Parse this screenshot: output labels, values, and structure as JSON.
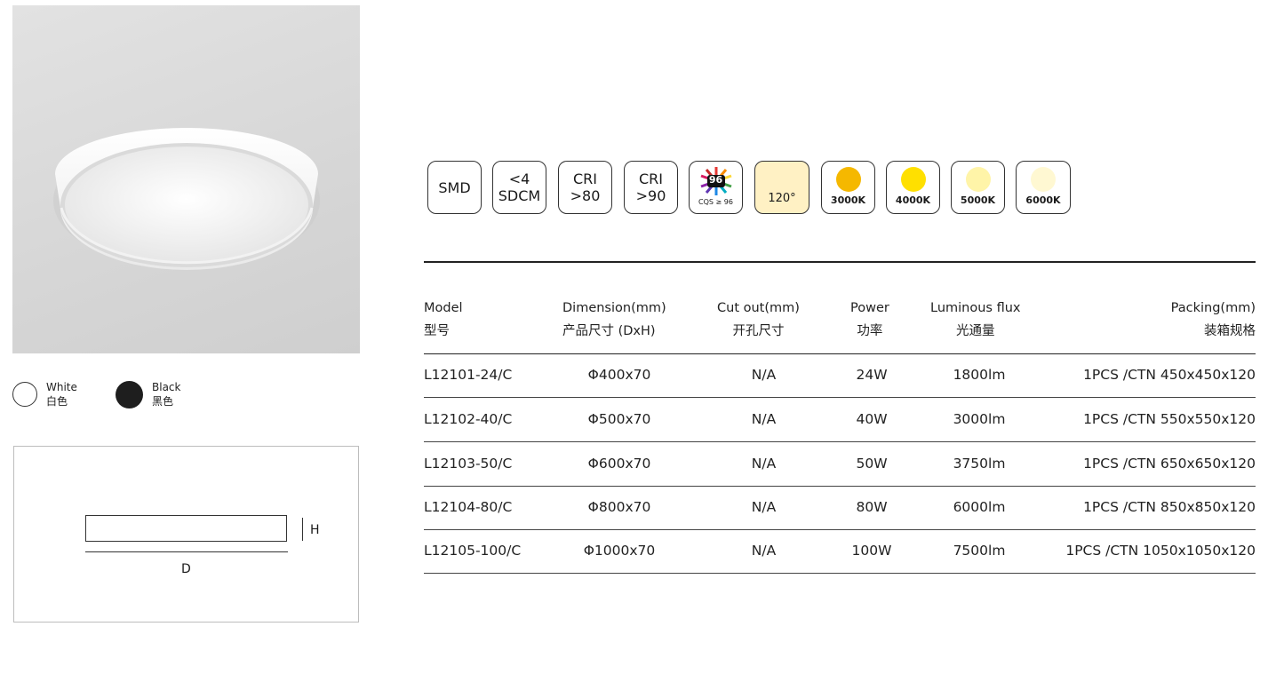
{
  "colors": {
    "white": "#ffffff",
    "black": "#1e1e1e",
    "k3000": "#f5b800",
    "k4000": "#ffe000",
    "k5000": "#fff4a8",
    "k6000": "#fff8d2",
    "beam": "#fff1c4"
  },
  "finishes": [
    {
      "en": "White",
      "zh": "白色"
    },
    {
      "en": "Black",
      "zh": "黑色"
    }
  ],
  "diagram": {
    "h_label": "H",
    "d_label": "D"
  },
  "features": {
    "smd": "SMD",
    "sdcm_line1": "<4",
    "sdcm_line2": "SDCM",
    "cri80_line1": "CRI",
    "cri80_line2": ">80",
    "cri90_line1": "CRI",
    "cri90_line2": ">90",
    "cqs_value": "96",
    "cqs_label": "CQS ≥ 96",
    "beam": "120°",
    "cct": [
      "3000K",
      "4000K",
      "5000K",
      "6000K"
    ]
  },
  "table": {
    "headers": [
      {
        "en": "Model",
        "zh": "型号"
      },
      {
        "en": "Dimension(mm)",
        "zh": "产品尺寸 (DxH)"
      },
      {
        "en": "Cut out(mm)",
        "zh": "开孔尺寸"
      },
      {
        "en": "Power",
        "zh": "功率"
      },
      {
        "en": "Luminous flux",
        "zh": "光通量"
      },
      {
        "en": "Packing(mm)",
        "zh": "装箱规格"
      }
    ],
    "rows": [
      {
        "model": "L12101-24/C",
        "dimension": "Φ400x70",
        "cutout": "N/A",
        "power": "24W",
        "flux": "1800lm",
        "packing": "1PCS /CTN 450x450x120"
      },
      {
        "model": "L12102-40/C",
        "dimension": "Φ500x70",
        "cutout": "N/A",
        "power": "40W",
        "flux": "3000lm",
        "packing": "1PCS /CTN 550x550x120"
      },
      {
        "model": "L12103-50/C",
        "dimension": "Φ600x70",
        "cutout": "N/A",
        "power": "50W",
        "flux": "3750lm",
        "packing": "1PCS /CTN 650x650x120"
      },
      {
        "model": "L12104-80/C",
        "dimension": "Φ800x70",
        "cutout": "N/A",
        "power": "80W",
        "flux": "6000lm",
        "packing": "1PCS /CTN 850x850x120"
      },
      {
        "model": "L12105-100/C",
        "dimension": "Φ1000x70",
        "cutout": "N/A",
        "power": "100W",
        "flux": "7500lm",
        "packing": "1PCS /CTN 1050x1050x120"
      }
    ]
  }
}
